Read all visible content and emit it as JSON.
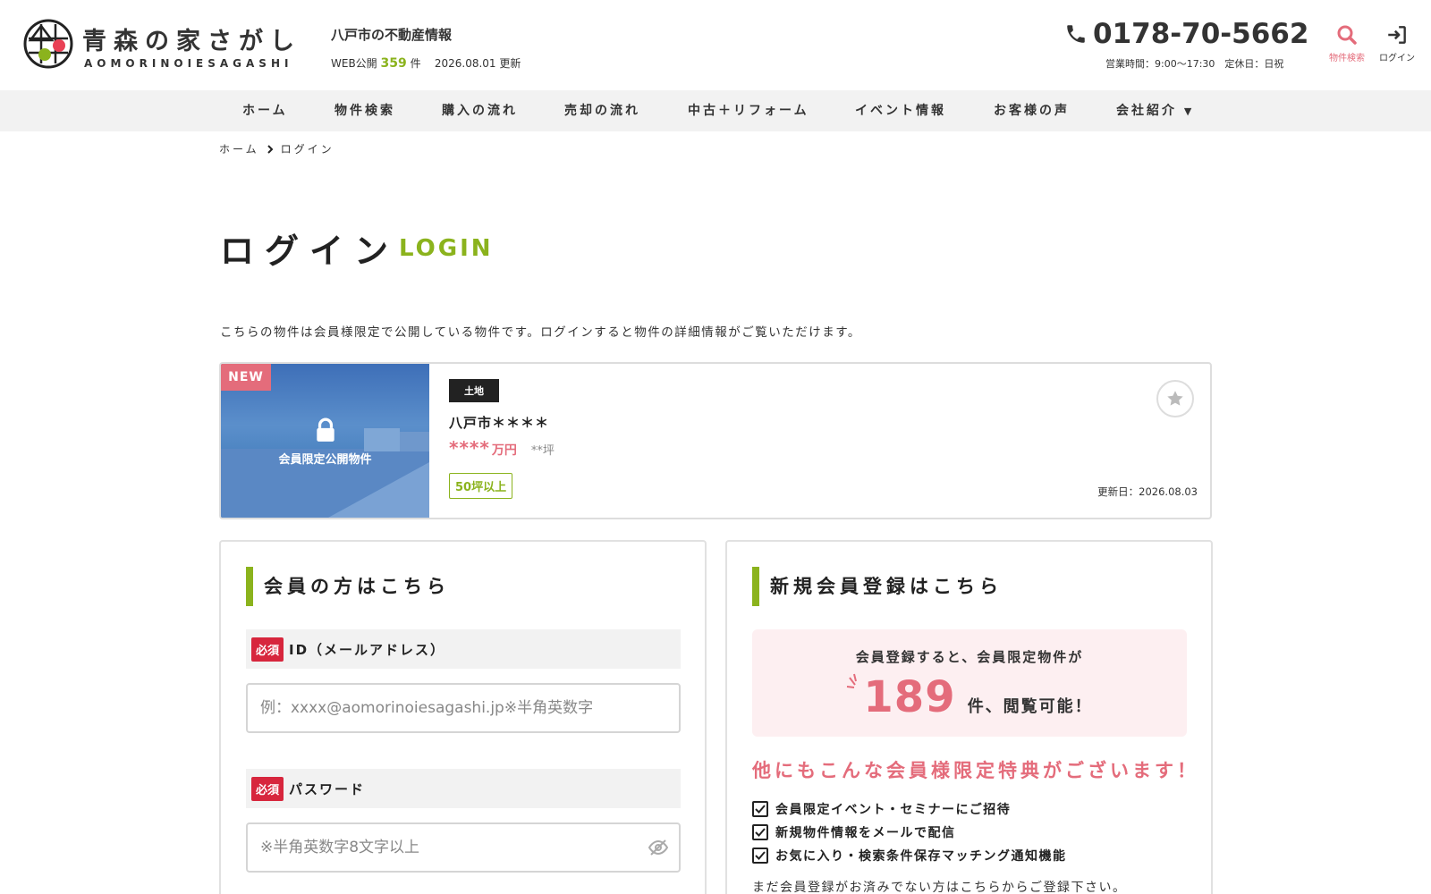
{
  "header": {
    "logo_title": "青森の家さがし",
    "logo_subtitle": "AOMORINOIESAGASHI",
    "site_description": "八戸市の不動産情報",
    "web_prefix": "WEB公開",
    "web_count": "359",
    "web_suffix": "件",
    "update_date": "2026.08.01 更新",
    "phone": "0178-70-5662",
    "hours": "営業時間：9:00〜17:30　定休日：日祝",
    "search_label": "物件検索",
    "login_label": "ログイン"
  },
  "nav": {
    "items": [
      "ホーム",
      "物件検索",
      "購入の流れ",
      "売却の流れ",
      "中古＋リフォーム",
      "イベント情報",
      "お客様の声",
      "会社紹介"
    ]
  },
  "breadcrumb": {
    "home": "ホーム",
    "current": "ログイン"
  },
  "page": {
    "title": "ログイン",
    "title_en": "LOGIN",
    "intro": "こちらの物件は会員様限定で公開している物件です。ログインすると物件の詳細情報がご覧いただけます。"
  },
  "property": {
    "badge_new": "NEW",
    "lock_label": "会員限定公開物件",
    "type": "土地",
    "name": "八戸市＊＊＊＊",
    "price": "****",
    "price_unit": "万円",
    "area": "**坪",
    "tag": "50坪以上",
    "updated": "更新日：2026.08.03"
  },
  "login_panel": {
    "heading": "会員の方はこちら",
    "required": "必須",
    "id_label": "ID（メールアドレス）",
    "id_placeholder": "例：xxxx@aomorinoiesagashi.jp※半角英数字",
    "password_label": "パスワード",
    "password_placeholder": "※半角英数字8文字以上"
  },
  "signup_panel": {
    "heading": "新規会員登録はこちら",
    "line1": "会員登録すると、会員限定物件が",
    "count": "189",
    "count_suffix": "件、閲覧可能！",
    "benefit_title": "他にもこんな会員様限定特典がございます！",
    "benefits": [
      "会員限定イベント・セミナーにご招待",
      "新規物件情報をメールで配信",
      "お気に入り・検索条件保存マッチング通知機能"
    ],
    "note": "まだ会員登録がお済みでない方はこちらからご登録下さい。"
  },
  "colors": {
    "accent_green": "#8bb31d",
    "accent_pink": "#e46c7b",
    "required_red": "#d7263d",
    "nav_bg": "#f2f2f2"
  }
}
